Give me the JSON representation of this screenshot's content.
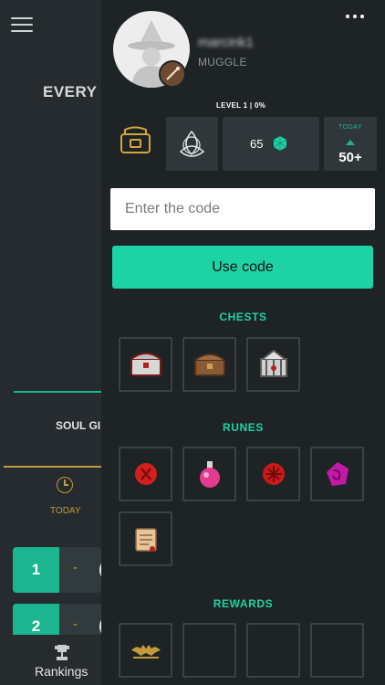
{
  "background": {
    "title": "EVERY",
    "tab_label": "SOUL GI",
    "period_label": "TODAY",
    "rows": [
      {
        "rank": "1",
        "dash": "-"
      },
      {
        "rank": "2",
        "dash": "-"
      }
    ],
    "nav_label": "Rankings"
  },
  "profile": {
    "username": "marcink1",
    "rank_title": "MUGGLE",
    "level_text": "LEVEL 1 | 0%"
  },
  "stats": {
    "gems": "65",
    "today_label": "TODAY",
    "today_value": "50+"
  },
  "code": {
    "placeholder": "Enter the code",
    "value": "",
    "button_label": "Use code"
  },
  "sections": {
    "chests_title": "CHESTS",
    "runes_title": "RUNES",
    "rewards_title": "REWARDS"
  },
  "colors": {
    "accent": "#1dd3a6",
    "gold": "#c49a3c",
    "panel": "#1e2325"
  }
}
